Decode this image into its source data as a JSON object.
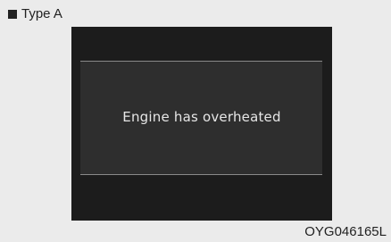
{
  "type_label": "Type A",
  "display": {
    "message": "Engine has overheated"
  },
  "image_code": "OYG046165L",
  "colors": {
    "page_background": "#ebebeb",
    "screen_background": "#1c1c1c",
    "screen_inner": "#2e2e2e",
    "message_text": "#e6e6e6"
  }
}
